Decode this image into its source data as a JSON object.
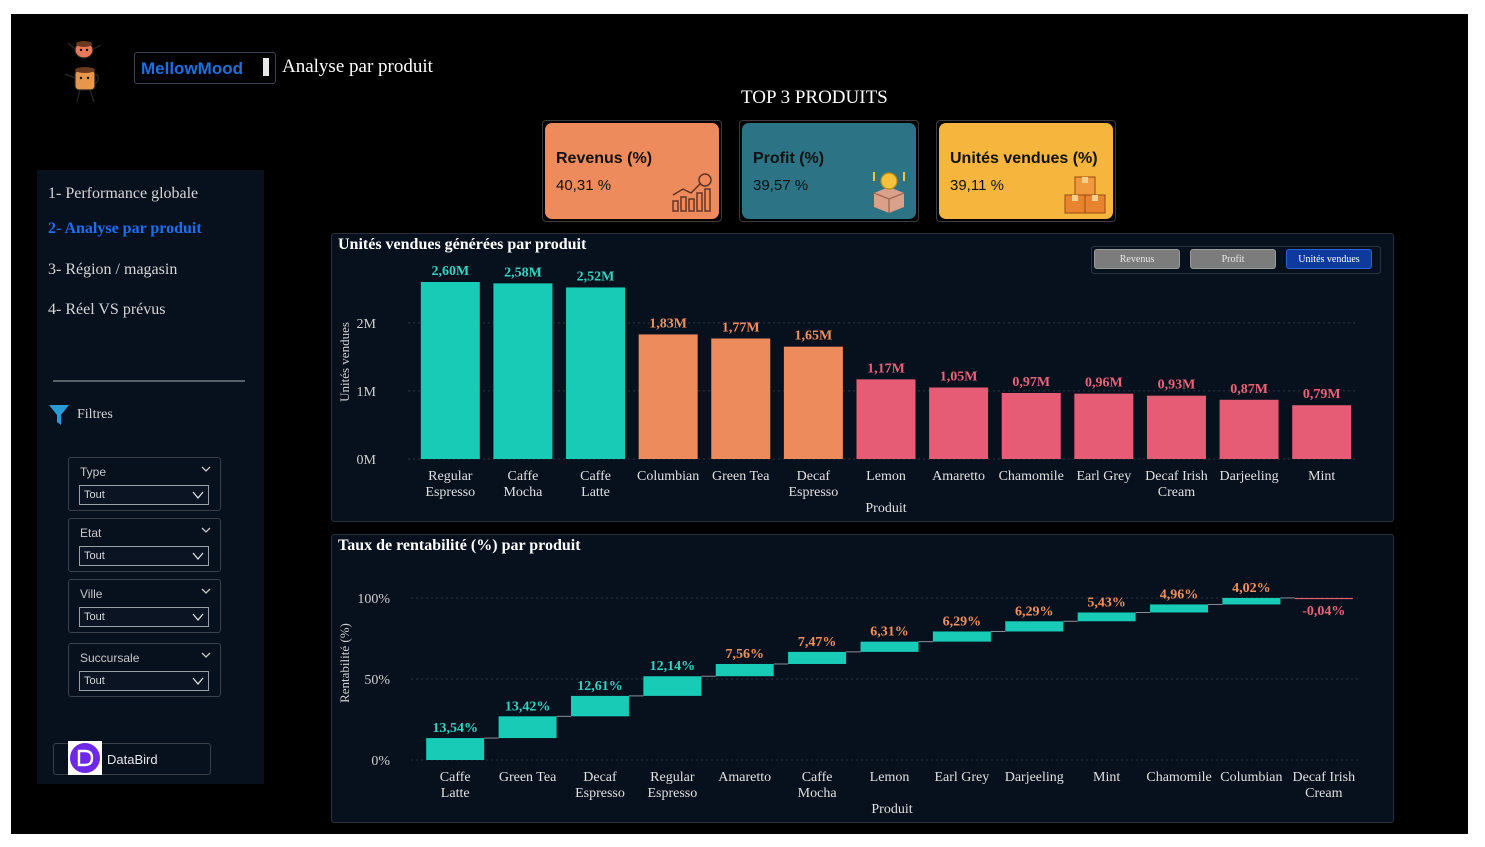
{
  "header": {
    "brand": "MellowMood",
    "page_title": "Analyse par produit",
    "top3_title": "TOP 3 PRODUITS"
  },
  "kpis": [
    {
      "label": "Revenus (%)",
      "value": "40,31 %",
      "color": "#ee8b5d",
      "icon": "revenue-chart-icon"
    },
    {
      "label": "Profit (%)",
      "value": "39,57 %",
      "color": "#2c7485",
      "icon": "coin-box-icon"
    },
    {
      "label": "Unités vendues (%)",
      "value": "39,11 %",
      "color": "#f6b63e",
      "icon": "boxes-icon"
    }
  ],
  "nav": {
    "items": [
      {
        "label": "1- Performance globale",
        "active": false
      },
      {
        "label": "2- Analyse par produit",
        "active": true
      },
      {
        "label": "3- Région / magasin",
        "active": false
      },
      {
        "label": "4- Réel VS prévus",
        "active": false
      }
    ],
    "filters_label": "Filtres",
    "slicers": [
      {
        "title": "Type",
        "value": "Tout"
      },
      {
        "title": "Etat",
        "value": "Tout"
      },
      {
        "title": "Ville",
        "value": "Tout"
      },
      {
        "title": "Succursale",
        "value": "Tout"
      }
    ],
    "partner": "DataBird"
  },
  "toggles": {
    "items": [
      {
        "label": "Revenus",
        "active": false
      },
      {
        "label": "Profit",
        "active": false
      },
      {
        "label": "Unités vendues",
        "active": true
      }
    ]
  },
  "colors": {
    "teal": "#17cbb6",
    "orange": "#ee8b5d",
    "red": "#e55c74",
    "teal_label": "#34d3c2",
    "orange_label": "#f0915f",
    "red_label": "#e96479"
  },
  "chart_data": [
    {
      "type": "bar",
      "title": "Unités vendues générées par produit",
      "xlabel": "Produit",
      "ylabel": "Unités vendues",
      "categories": [
        "Regular Espresso",
        "Caffe Mocha",
        "Caffe Latte",
        "Columbian",
        "Green Tea",
        "Decaf Espresso",
        "Lemon",
        "Amaretto",
        "Chamomile",
        "Earl Grey",
        "Decaf Irish Cream",
        "Darjeeling",
        "Mint"
      ],
      "values": [
        2.6,
        2.58,
        2.52,
        1.83,
        1.77,
        1.65,
        1.17,
        1.05,
        0.97,
        0.96,
        0.93,
        0.87,
        0.79
      ],
      "value_unit": "M",
      "data_labels": [
        "2,60M",
        "2,58M",
        "2,52M",
        "1,83M",
        "1,77M",
        "1,65M",
        "1,17M",
        "1,05M",
        "0,97M",
        "0,96M",
        "0,93M",
        "0,87M",
        "0,79M"
      ],
      "groups": [
        "teal",
        "teal",
        "teal",
        "orange",
        "orange",
        "orange",
        "red",
        "red",
        "red",
        "red",
        "red",
        "red",
        "red"
      ],
      "yticks": [
        "0M",
        "1M",
        "2M"
      ],
      "ylim": [
        0,
        2.6
      ],
      "grid": true
    },
    {
      "type": "waterfall",
      "title": "Taux de rentabilité (%) par produit",
      "xlabel": "Produit",
      "ylabel": "Rentabilité (%)",
      "categories": [
        "Caffe Latte",
        "Green Tea",
        "Decaf Espresso",
        "Regular Espresso",
        "Amaretto",
        "Caffe Mocha",
        "Lemon",
        "Earl Grey",
        "Darjeeling",
        "Mint",
        "Chamomile",
        "Columbian",
        "Decaf Irish Cream"
      ],
      "values": [
        13.54,
        13.42,
        12.61,
        12.14,
        7.56,
        7.47,
        6.31,
        6.29,
        6.29,
        5.43,
        4.96,
        4.02,
        -0.04
      ],
      "data_labels": [
        "13,54%",
        "13,42%",
        "12,61%",
        "12,14%",
        "7,56%",
        "7,47%",
        "6,31%",
        "6,29%",
        "6,29%",
        "5,43%",
        "4,96%",
        "4,02%",
        "-0,04%"
      ],
      "label_groups": [
        "teal",
        "teal",
        "teal",
        "teal",
        "orange",
        "orange",
        "orange",
        "orange",
        "orange",
        "orange",
        "orange",
        "orange",
        "red"
      ],
      "yticks": [
        "0%",
        "50%",
        "100%"
      ],
      "ylim": [
        0,
        100
      ],
      "grid": true
    }
  ]
}
